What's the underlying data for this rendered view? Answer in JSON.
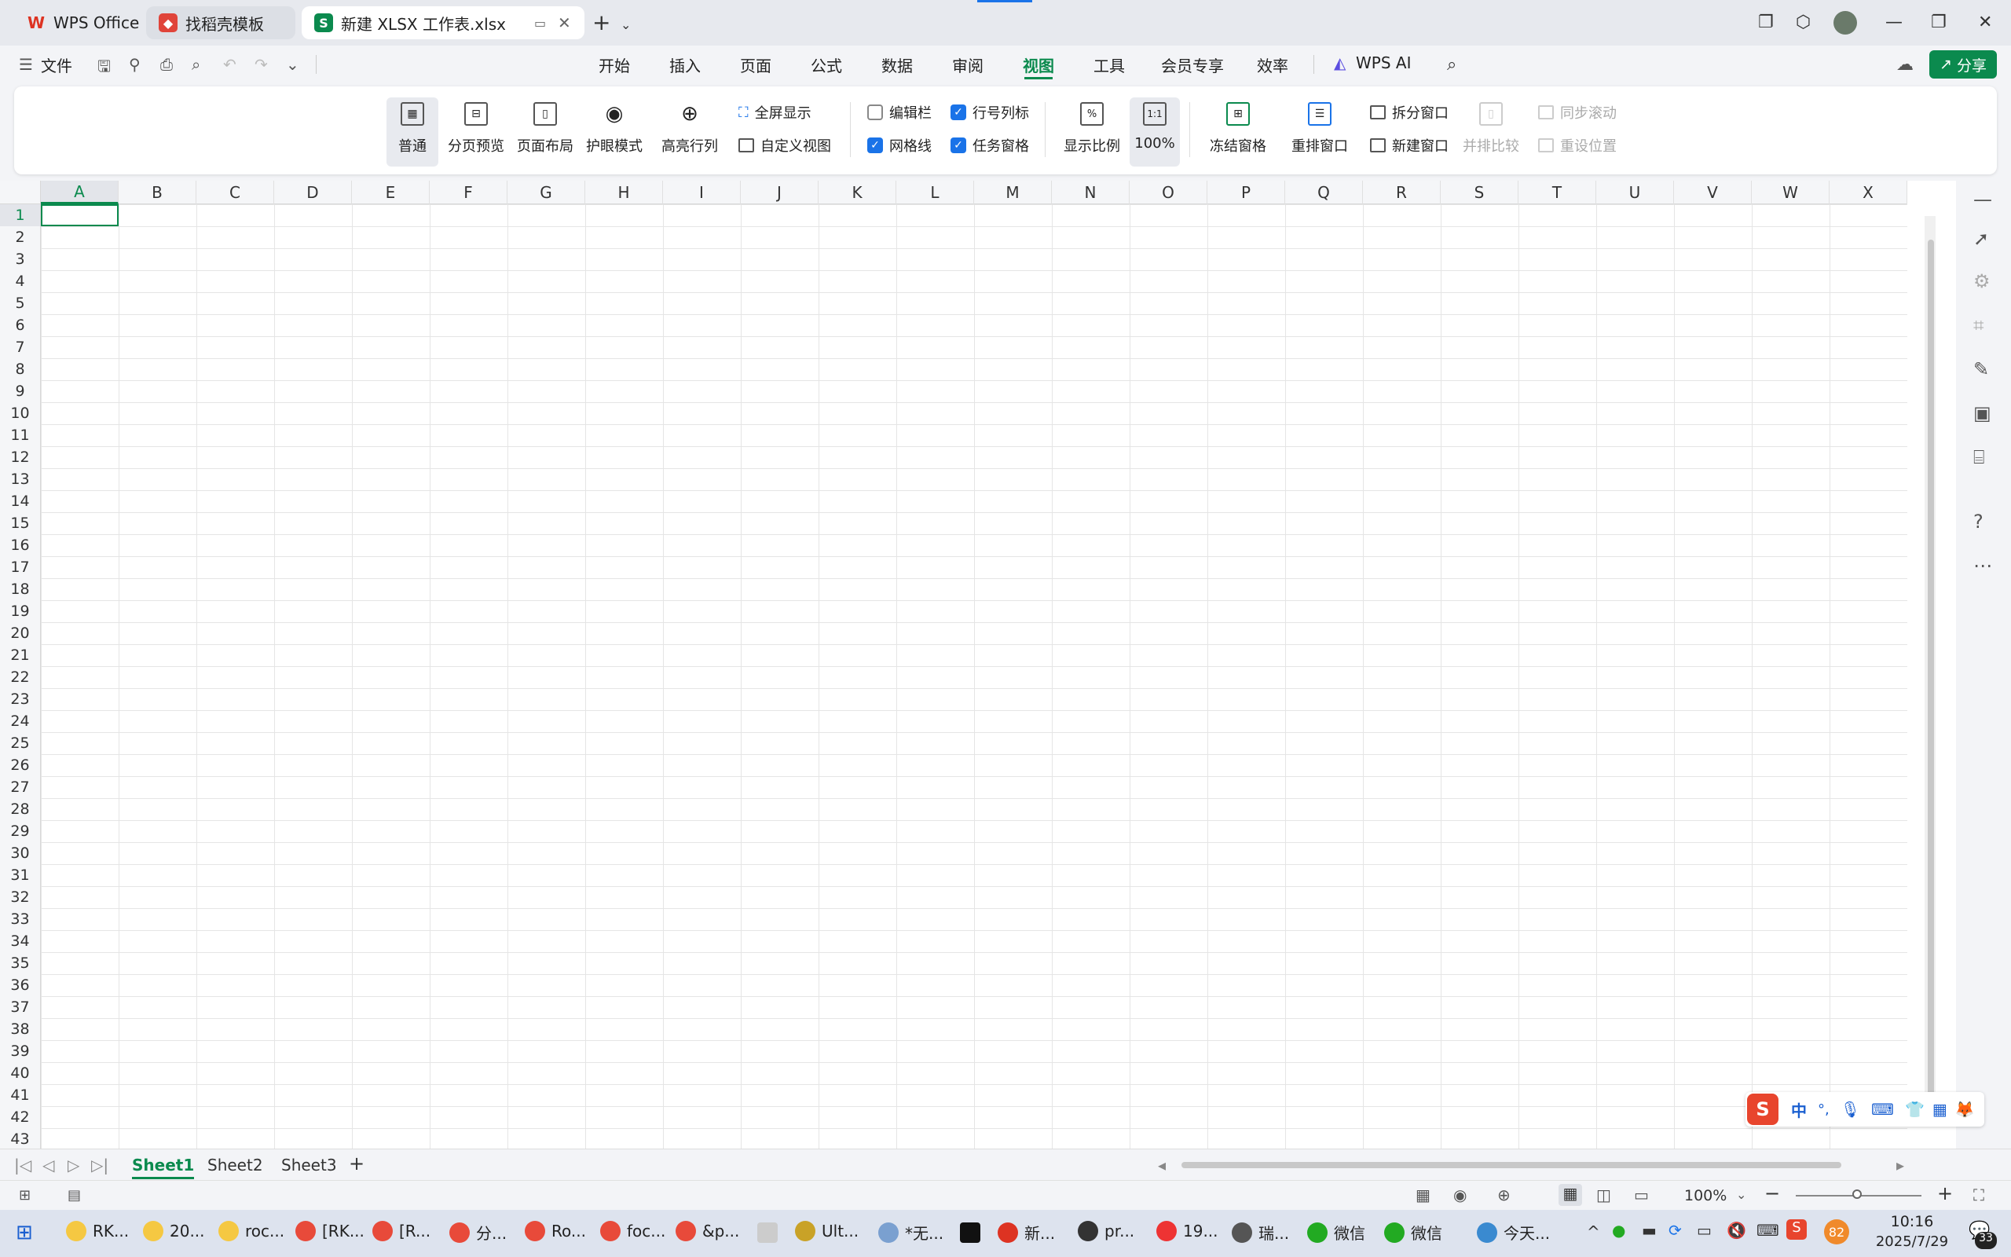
{
  "tabs": [
    {
      "label": "WPS Office",
      "icon": "wps-logo-icon"
    },
    {
      "label": "找稻壳模板",
      "icon": "docer-icon"
    },
    {
      "label": "新建 XLSX 工作表.xlsx",
      "icon": "sheet-icon",
      "icon_text": "S"
    }
  ],
  "menubar": {
    "file_label": "文件",
    "items": [
      "开始",
      "插入",
      "页面",
      "公式",
      "数据",
      "审阅",
      "视图",
      "工具",
      "会员专享",
      "效率"
    ],
    "active": "视图",
    "wps_ai_label": "WPS AI",
    "share_label": "分享"
  },
  "ribbon": {
    "normal": "普通",
    "page_break_preview": "分页预览",
    "page_layout": "页面布局",
    "eye_protection": "护眼模式",
    "highlight": "高亮行列",
    "fullscreen": "全屏显示",
    "custom_view": "自定义视图",
    "formula_bar": "编辑栏",
    "headings": "行号列标",
    "gridlines": "网格线",
    "task_pane": "任务窗格",
    "zoom": "显示比例",
    "zoom_100": "100%",
    "zoom_100_icon_text": "1:1",
    "freeze": "冻结窗格",
    "arrange": "重排窗口",
    "split": "拆分窗口",
    "new_window": "新建窗口",
    "side_by_side": "并排比较",
    "sync_scroll": "同步滚动",
    "reset_position": "重设位置"
  },
  "columns": [
    "A",
    "B",
    "C",
    "D",
    "E",
    "F",
    "G",
    "H",
    "I",
    "J",
    "K",
    "L",
    "M",
    "N",
    "O",
    "P",
    "Q",
    "R",
    "S",
    "T",
    "U",
    "V",
    "W",
    "X"
  ],
  "rows": [
    "1",
    "2",
    "3",
    "4",
    "5",
    "6",
    "7",
    "8",
    "9",
    "10",
    "11",
    "12",
    "13",
    "14",
    "15",
    "16",
    "17",
    "18",
    "19",
    "20",
    "21",
    "22",
    "23",
    "24",
    "25",
    "26",
    "27",
    "28",
    "29",
    "30",
    "31",
    "32",
    "33",
    "34",
    "35",
    "36",
    "37",
    "38",
    "39",
    "40",
    "41",
    "42",
    "43"
  ],
  "sheets": [
    "Sheet1",
    "Sheet2",
    "Sheet3"
  ],
  "status": {
    "zoom": "100%"
  },
  "ime": {
    "mode": "中",
    "punct": "°,"
  },
  "taskbar": {
    "items": [
      "RK...",
      "20...",
      "roc...",
      "[RK...",
      "[R...",
      "分...",
      "Ro...",
      "foc...",
      "&p...",
      "Ult...",
      "*无...",
      "新...",
      "pr...",
      "19...",
      "瑞...",
      "微信",
      "微信",
      "今天..."
    ],
    "time": "10:16",
    "date": "2025/7/29",
    "tray_badge": "82",
    "notif_count": "33"
  },
  "colors": {
    "accent": "#0b8a4e",
    "checkbox": "#1a73e8"
  }
}
